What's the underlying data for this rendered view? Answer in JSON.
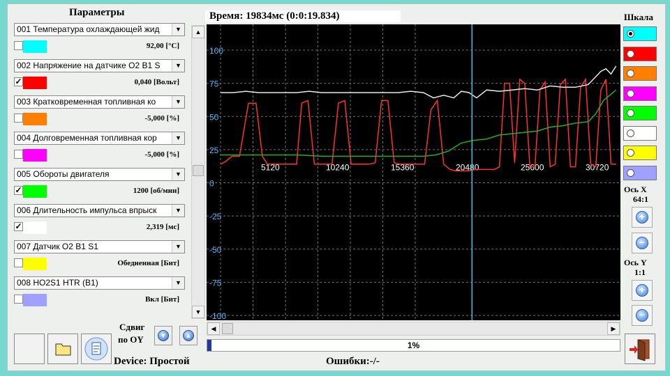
{
  "left_panel": {
    "title": "Параметры",
    "parameters": [
      {
        "name": "001 Температура охлаждающей жид",
        "value": "92,00 [°С]",
        "checked": false,
        "color": "#00ffff"
      },
      {
        "name": "002 Напряжение на датчике О2 B1 S",
        "value": "0,040 [Вольт]",
        "checked": true,
        "color": "#ff0000"
      },
      {
        "name": "003 Кратковременная топливная ко",
        "value": "-5,000 [%]",
        "checked": false,
        "color": "#ff8000"
      },
      {
        "name": "004 Долговременная топливная кор",
        "value": "-5,000 [%]",
        "checked": false,
        "color": "#ff00ff"
      },
      {
        "name": "005 Обороты двигателя",
        "value": "1200 [об/мин]",
        "checked": true,
        "color": "#00ff00"
      },
      {
        "name": "006 Длительность импульса впрыск",
        "value": "2,319 [мс]",
        "checked": true,
        "color": "#ffffff"
      },
      {
        "name": "007 Датчик О2 В1 S1",
        "value": "Обедненная [Бит]",
        "checked": false,
        "color": "#ffff00"
      },
      {
        "name": "008 HO2S1 HTR (B1)",
        "value": "Вкл [Бит]",
        "checked": false,
        "color": "#a0a0ff"
      }
    ]
  },
  "header": {
    "time_label": "Время: 19834мс (0:0:19.834)"
  },
  "chart_data": {
    "type": "line",
    "ylim": [
      -100,
      110
    ],
    "y_ticks": [
      "100",
      "75",
      "50",
      "25",
      "0",
      "-25",
      "-50",
      "-75",
      "-100"
    ],
    "x_ticks": [
      "5120",
      "10240",
      "15360",
      "20480",
      "25600",
      "30720"
    ],
    "grid": true,
    "cursor_x": 19834,
    "series": [
      {
        "color": "#ff3030",
        "x": [
          0,
          400,
          900,
          1500,
          2200,
          2800,
          3300,
          3700,
          4200,
          4700,
          5200,
          5600,
          6000,
          6400,
          6900,
          7400,
          7800,
          8300,
          8800,
          9300,
          9800,
          10300,
          10800,
          11200,
          11700,
          12200,
          12700,
          13200,
          13700,
          14200,
          14700,
          15100,
          15600,
          16100,
          16600,
          17100,
          17600,
          18100,
          18600,
          19100,
          19600,
          20100,
          20600,
          21100,
          21600,
          22000,
          22400,
          22800,
          23200,
          23600,
          24000,
          24400,
          24800,
          25200,
          25600,
          26000,
          26400,
          26800,
          27200,
          27600,
          28000,
          28400,
          28800,
          29200,
          29600,
          30000,
          30400,
          30800,
          31200
        ],
        "y": [
          14,
          16,
          20,
          20,
          60,
          60,
          20,
          14,
          14,
          14,
          14,
          14,
          14,
          60,
          62,
          14,
          14,
          14,
          14,
          60,
          62,
          14,
          14,
          14,
          14,
          15,
          62,
          62,
          15,
          14,
          14,
          14,
          14,
          14,
          55,
          62,
          14,
          10,
          9,
          9,
          9,
          10,
          10,
          10,
          10,
          12,
          75,
          75,
          15,
          78,
          75,
          12,
          12,
          70,
          76,
          12,
          14,
          74,
          78,
          12,
          12,
          72,
          78,
          14,
          12,
          70,
          78,
          14,
          14
        ]
      },
      {
        "color": "#e8e8e8",
        "x": [
          0,
          1000,
          2000,
          3000,
          4000,
          5000,
          6000,
          7000,
          8000,
          9000,
          10000,
          11000,
          12000,
          13000,
          14000,
          15000,
          16000,
          16800,
          17600,
          18400,
          19000,
          19600,
          20200,
          21000,
          22000,
          23000,
          24000,
          25000,
          26000,
          27000,
          28000,
          29000,
          29600,
          30000,
          30400,
          30800,
          31200
        ],
        "y": [
          68,
          68,
          69,
          68,
          68,
          68,
          68,
          69,
          68,
          68,
          68,
          68,
          68,
          68,
          68,
          69,
          68,
          64,
          66,
          64,
          69,
          68,
          64,
          70,
          69,
          70,
          71,
          70,
          73,
          72,
          72,
          74,
          80,
          84,
          86,
          82,
          88
        ]
      },
      {
        "color": "#20b020",
        "x": [
          0,
          2000,
          4000,
          6000,
          8000,
          10000,
          12000,
          14000,
          16000,
          17000,
          18000,
          19000,
          20000,
          21000,
          22000,
          23000,
          24000,
          25000,
          26000,
          27000,
          28000,
          29000,
          29600,
          30200,
          31200
        ],
        "y": [
          21,
          21,
          21,
          21,
          20,
          20,
          20,
          20,
          20,
          21,
          24,
          30,
          32,
          33,
          36,
          37,
          38,
          39,
          42,
          43,
          45,
          46,
          52,
          62,
          70
        ]
      }
    ]
  },
  "right_panel": {
    "scale_label": "Шкала",
    "scale_colors": [
      "#00ffff",
      "#ff0000",
      "#ff8000",
      "#ff00ff",
      "#00ff00",
      "#ffffff",
      "#ffff00",
      "#a0a0ff"
    ],
    "selected_index": 0,
    "x_axis_label": "Ось X",
    "x_axis_ratio": "64:1",
    "y_axis_label": "Ось Y",
    "y_axis_ratio": "1:1"
  },
  "bottom": {
    "shift_label": "Сдвиг",
    "shift_label2": "по OY",
    "device_label": "Device: Простой",
    "errors_label": "Ошибки:-/-",
    "progress_text": "1%",
    "progress_value": 0.01
  }
}
